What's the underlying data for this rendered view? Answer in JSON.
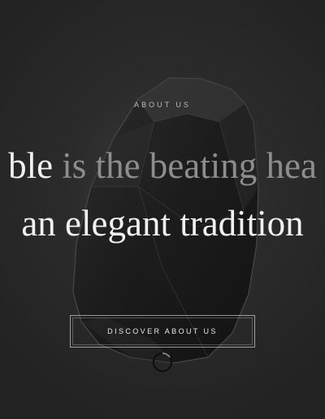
{
  "hero": {
    "eyebrow": "ABOUT US",
    "headline": {
      "line1_bright": "ble",
      "line1_dim": "is the beating hea",
      "line2": "an elegant tradition"
    },
    "cta_label": "DISCOVER ABOUT US",
    "scroll_icon": "circle-scroll-icon"
  },
  "colors": {
    "background": "#262626",
    "text_bright": "#f1f1f1",
    "text_dim": "#8d8d8d"
  }
}
